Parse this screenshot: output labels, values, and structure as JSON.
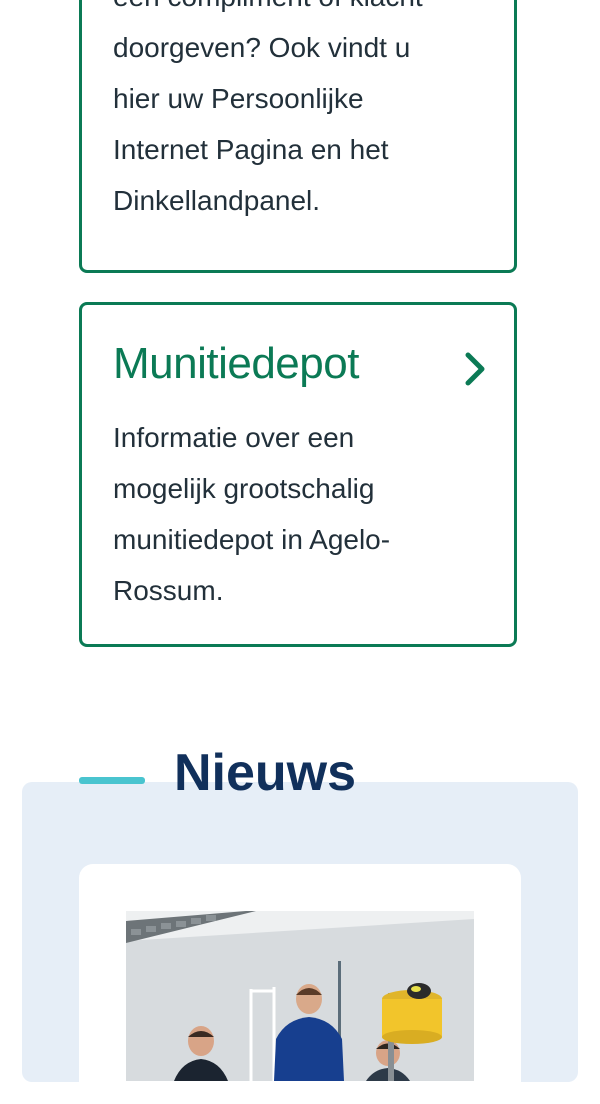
{
  "card_top": {
    "lines": [
      "een compliment of klacht",
      "doorgeven? Ook vindt u",
      "hier uw Persoonlijke",
      "Internet Pagina en het",
      "Dinkellandpanel."
    ]
  },
  "card_munitiedepot": {
    "title": "Munitiedepot",
    "description": "Informatie over een mogelijk grootschalig munitiedepot in Agelo-Rossum.",
    "icon": "chevron-right-icon"
  },
  "news": {
    "title": "Nieuws"
  },
  "colors": {
    "accent_green": "#0b7a55",
    "heading_navy": "#11305b",
    "bar_teal": "#49c4cf",
    "section_bg": "#e6eef7"
  }
}
